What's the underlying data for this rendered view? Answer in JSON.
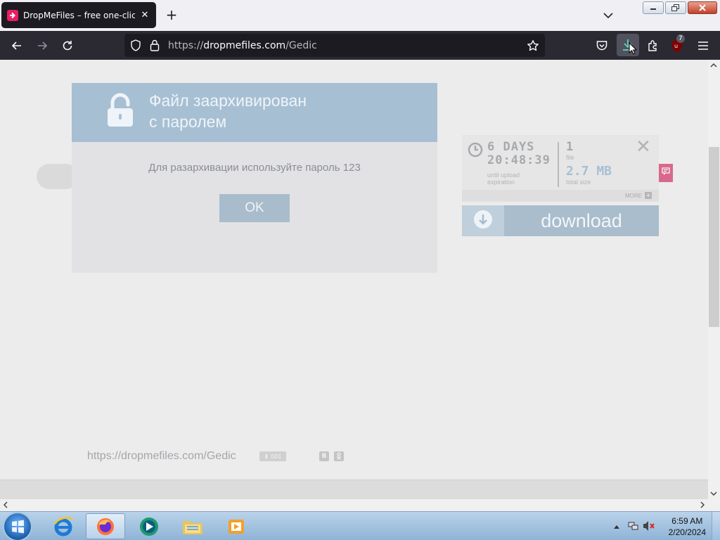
{
  "browser": {
    "tab": {
      "title": "DropMeFiles – free one-click file"
    },
    "url": {
      "prefix": "https://",
      "host": "dropmefiles.com",
      "path": "/Gedic"
    },
    "extension_badge": "7"
  },
  "dialog": {
    "title_line1": "Файл заархивирован",
    "title_line2": "с паролем",
    "message": "Для разархивации используйте пароль 123",
    "ok_label": "OK"
  },
  "file_info": {
    "days": "6 DAYS",
    "time": "20:48:39",
    "expiration_label_1": "until upload",
    "expiration_label_2": "expiration",
    "file_count": "1",
    "file_label": "file",
    "total_size": "2.7 MB",
    "total_size_label": "total size",
    "more_label": "MORE"
  },
  "download": {
    "label": "download"
  },
  "footer": {
    "page_url": "https://dropmefiles.com/Gedic",
    "qr_label": "001",
    "social_vk": "В",
    "social_ok": "ok"
  },
  "taskbar": {
    "time": "6:59 AM",
    "date": "2/20/2024"
  },
  "colors": {
    "accent_blue": "#a7bfd3",
    "favicon_pink": "#e91e63",
    "browser_dark": "#2b2a33"
  }
}
